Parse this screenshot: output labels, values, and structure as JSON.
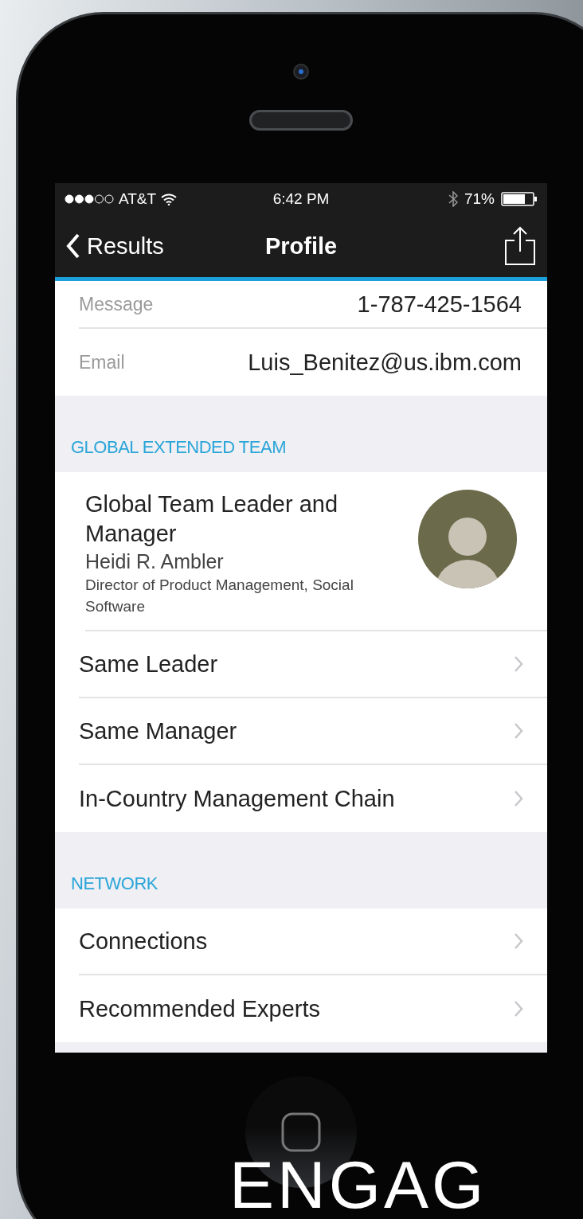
{
  "status_bar": {
    "carrier": "AT&T",
    "time": "6:42 PM",
    "battery": "71%"
  },
  "nav": {
    "back": "Results",
    "title": "Profile"
  },
  "contact_rows": [
    {
      "label": "Message",
      "value": "1-787-425-1564"
    },
    {
      "label": "Email",
      "value": "Luis_Benitez@us.ibm.com"
    }
  ],
  "sections": [
    {
      "header": "GLOBAL EXTENDED TEAM",
      "leader": {
        "role": "Global Team Leader and Manager",
        "name": "Heidi R. Ambler",
        "title": "Director of Product Management, Social Software"
      },
      "items": [
        "Same Leader",
        "Same Manager",
        "In-Country Management Chain"
      ]
    },
    {
      "header": "NETWORK",
      "items": [
        "Connections",
        "Recommended Experts"
      ]
    }
  ],
  "caption": "ENGAG"
}
